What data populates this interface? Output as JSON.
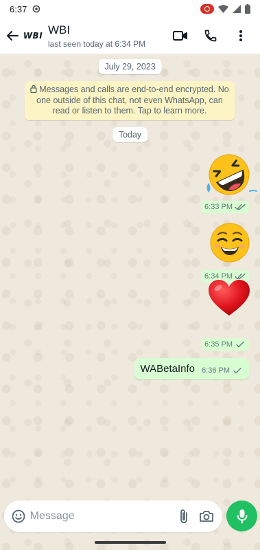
{
  "status_bar": {
    "time": "6:37"
  },
  "header": {
    "avatar_text": "WBI",
    "contact_name": "WBI",
    "last_seen": "last seen today at 6:34 PM"
  },
  "chat": {
    "date_chip": "July 29, 2023",
    "encryption_notice": "Messages and calls are end-to-end encrypted. No one outside of this chat, not even WhatsApp, can read or listen to them. Tap to learn more.",
    "today_chip": "Today",
    "messages": [
      {
        "type": "sticker",
        "sticker": "rolling-laughing",
        "time": "6:33 PM"
      },
      {
        "type": "sticker",
        "sticker": "smiling-face",
        "time": "6:34 PM"
      },
      {
        "type": "sticker",
        "sticker": "red-heart",
        "time": "6:35 PM"
      },
      {
        "type": "text",
        "text": "WABetaInfo",
        "time": "6:36 PM"
      }
    ]
  },
  "composer": {
    "placeholder": "Message"
  },
  "colors": {
    "accent": "#21c063",
    "bubble_outgoing": "#d9fdd3",
    "notice_bg": "#fdf4c5",
    "read_tick": "#53bdeb"
  }
}
